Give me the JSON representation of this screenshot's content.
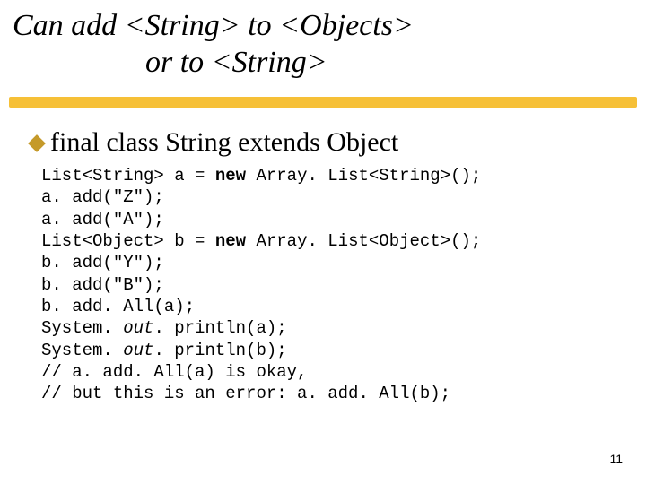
{
  "title": {
    "line1": "Can add <String> to <Objects>",
    "line2": "or to <String>"
  },
  "bullet": "final class String extends Object",
  "code": {
    "l1a": "List<String> a = ",
    "l1b": "new",
    "l1c": " Array. List<String>();",
    "l2": "a. add(\"Z\");",
    "l3": "a. add(\"A\");",
    "l4a": "List<Object> b = ",
    "l4b": "new",
    "l4c": " Array. List<Object>();",
    "l5": "b. add(\"Y\");",
    "l6": "b. add(\"B\");",
    "l7": "b. add. All(a);",
    "l8a": "System. ",
    "l8b": "out",
    "l8c": ". println(a);",
    "l9a": "System. ",
    "l9b": "out",
    "l9c": ". println(b);",
    "l10": "// a. add. All(a) is okay,",
    "l11": "// but this is an error: a. add. All(b);"
  },
  "page_number": "11"
}
